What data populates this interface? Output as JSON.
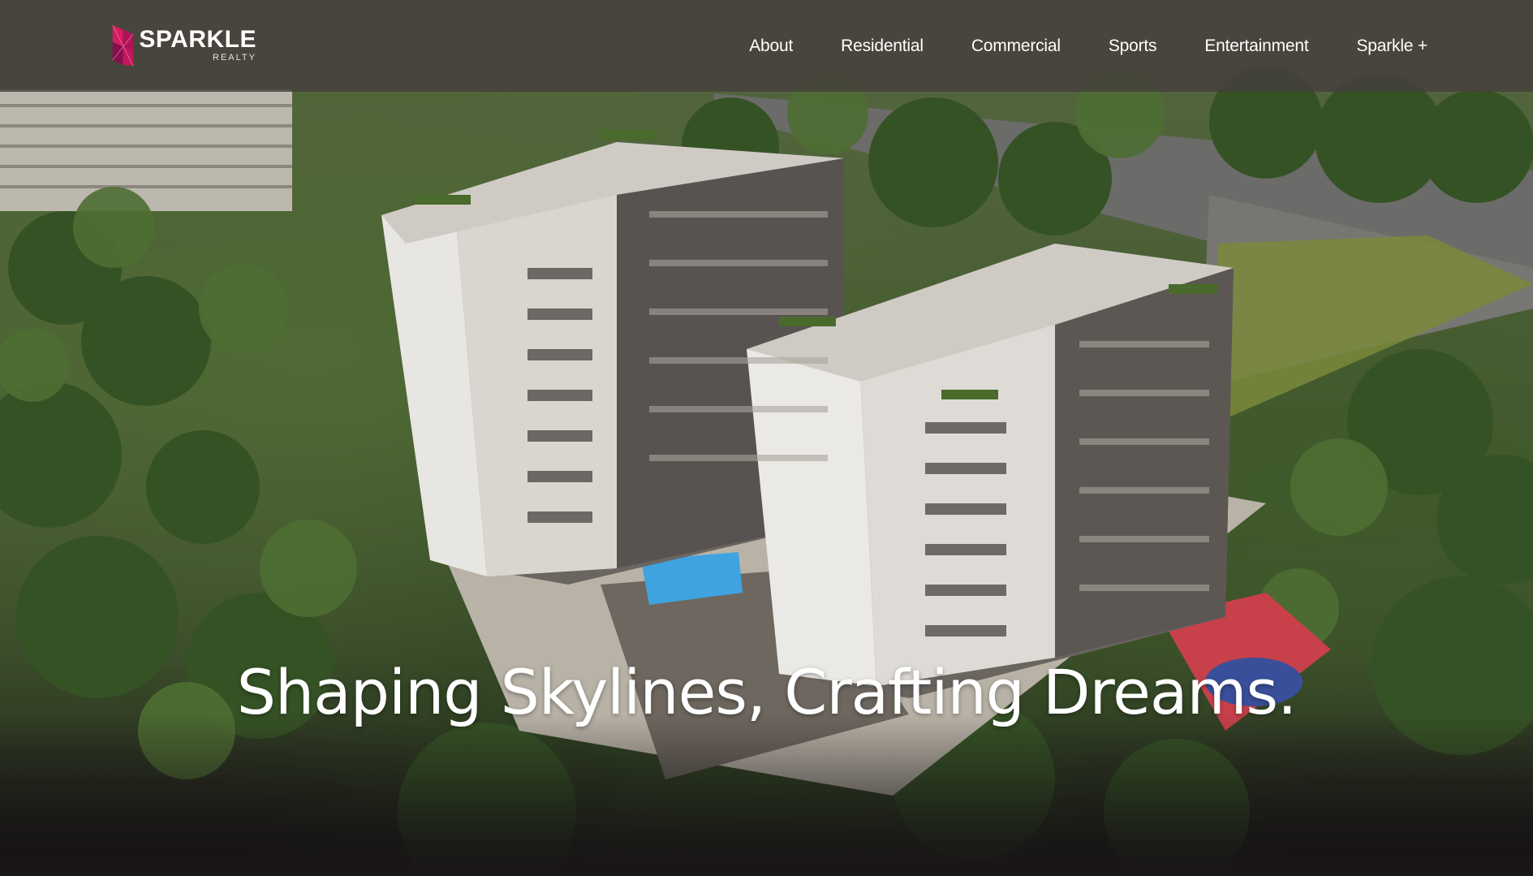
{
  "brand": {
    "name": "SPARKLE",
    "subtitle": "REALTY",
    "accent_color": "#c2185b"
  },
  "nav": {
    "items": [
      {
        "label": "About"
      },
      {
        "label": "Residential"
      },
      {
        "label": "Commercial"
      },
      {
        "label": "Sports"
      },
      {
        "label": "Entertainment"
      },
      {
        "label": "Sparkle +"
      }
    ]
  },
  "hero": {
    "headline": "Shaping Skylines, Crafting Dreams.",
    "image_alt": "aerial-render-residential-towers"
  }
}
